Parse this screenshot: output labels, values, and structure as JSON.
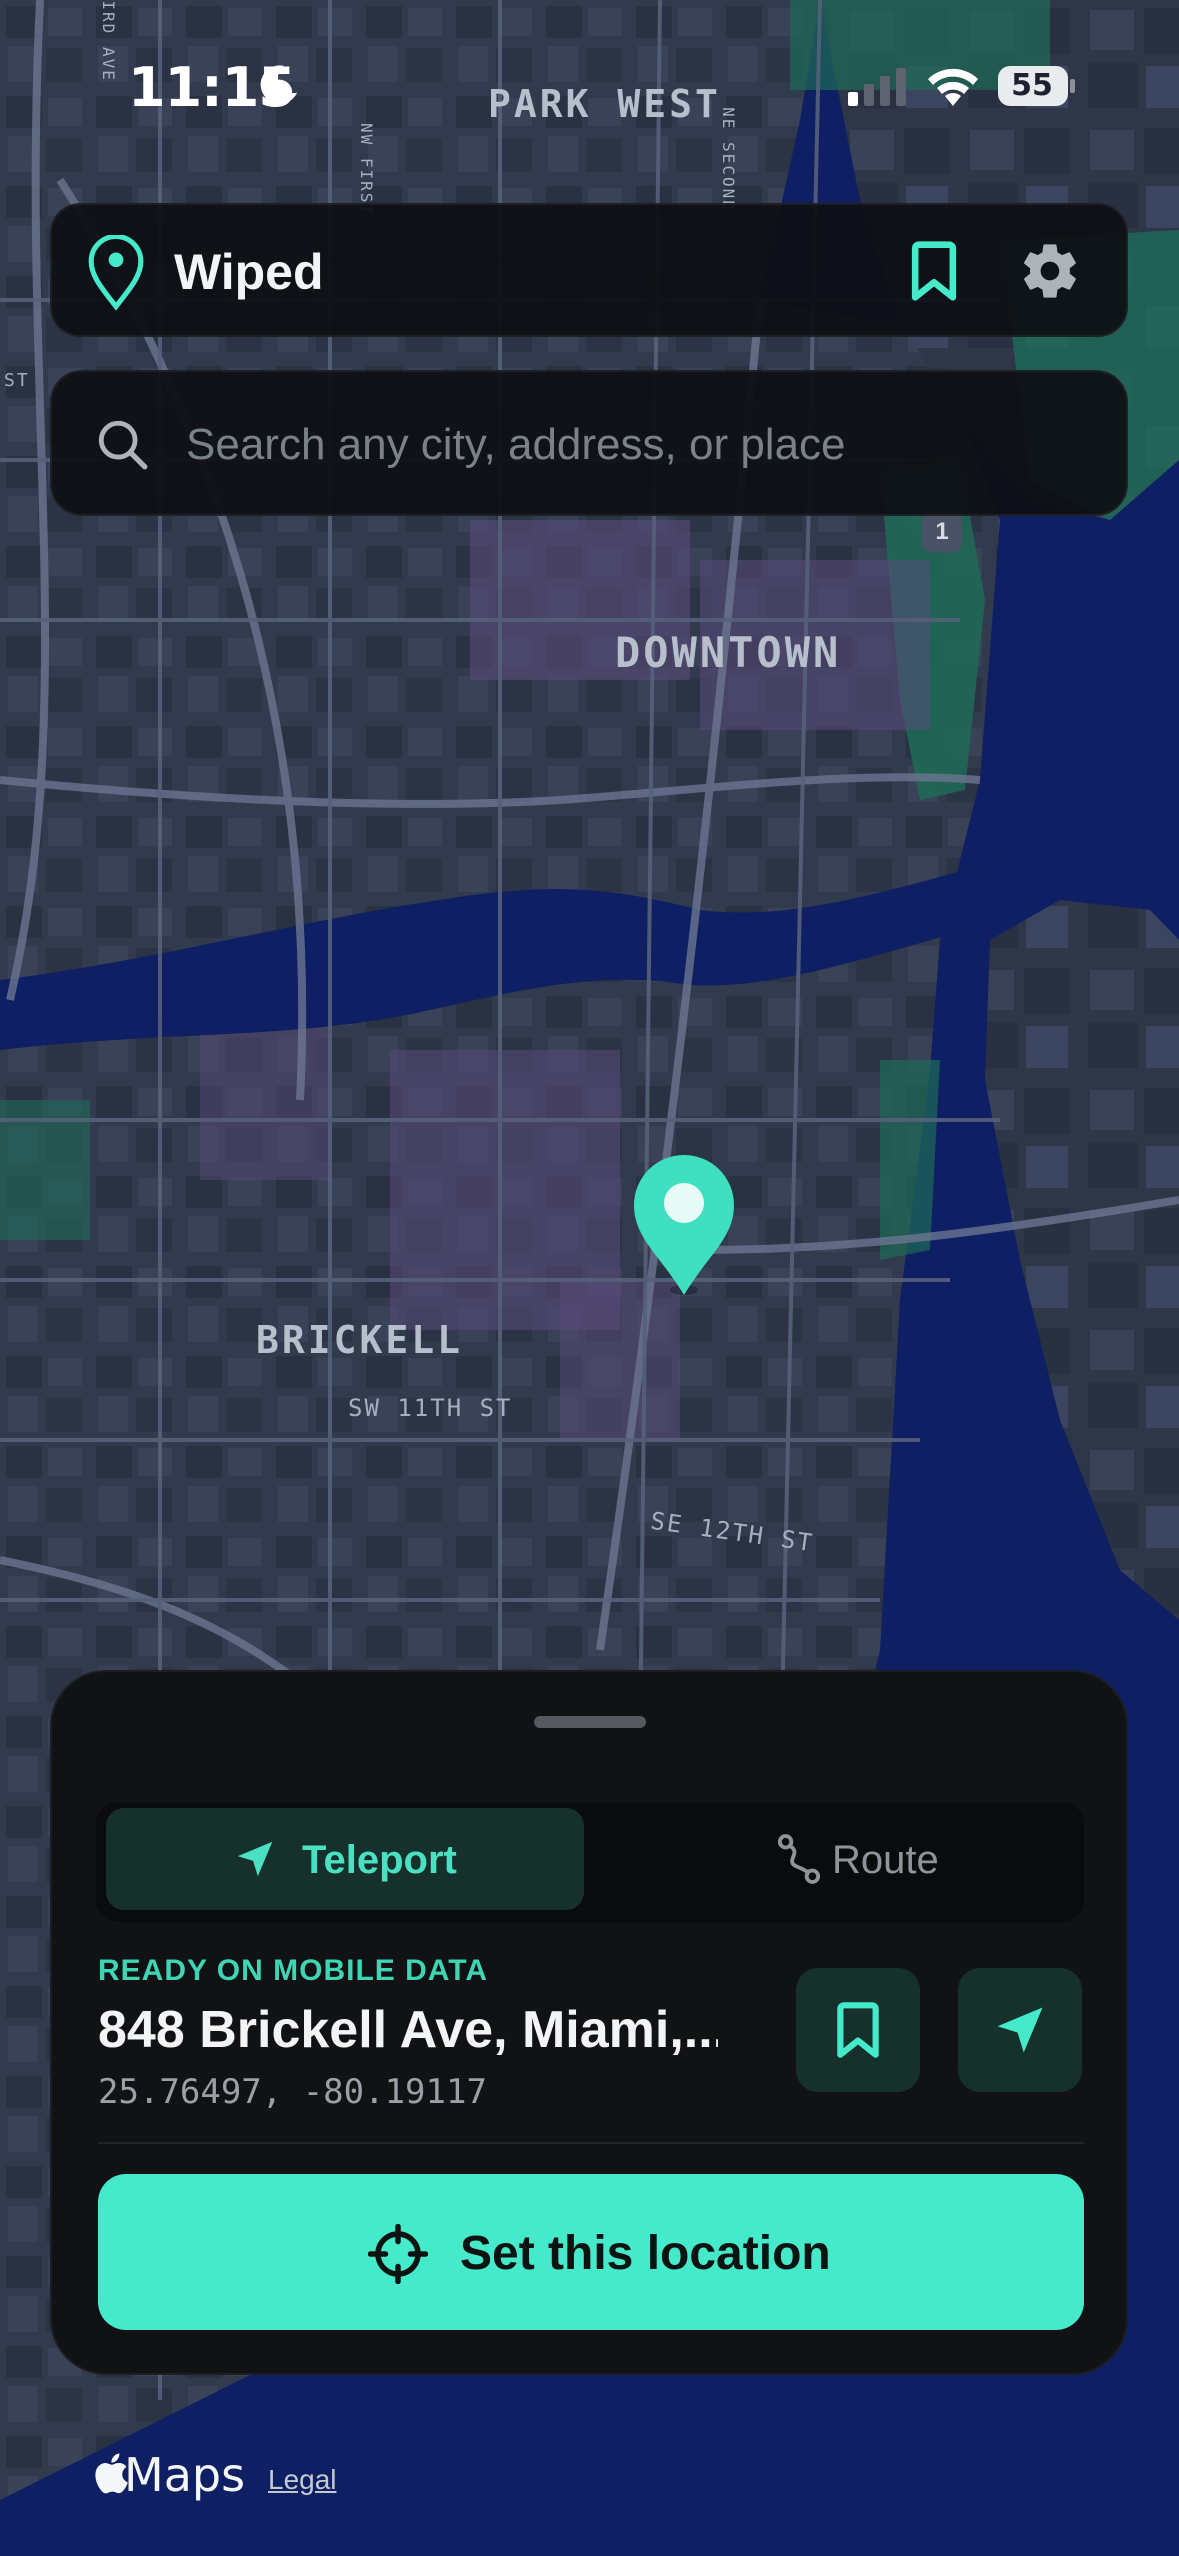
{
  "status_bar": {
    "time": "11:15",
    "battery": "55"
  },
  "header": {
    "app_title": "Wiped"
  },
  "search": {
    "placeholder": "Search any city, address, or place"
  },
  "map": {
    "labels": {
      "park_west": "PARK WEST",
      "downtown": "DOWNTOWN",
      "brickell": "BRICKELL",
      "sw_11th": "SW 11TH ST",
      "se_12th": "SE 12TH ST",
      "third_ave": "THIRD AVE",
      "nw_first": "NW FIRST",
      "ne_second": "NE SECOND",
      "st": "ST",
      "highway": "1"
    }
  },
  "sheet": {
    "tabs": [
      {
        "label": "Teleport",
        "active": true
      },
      {
        "label": "Route",
        "active": false
      }
    ],
    "status": "READY ON MOBILE DATA",
    "address": "848 Brickell Ave, Miami,...",
    "coordinates": "25.76497, -80.19117",
    "cta_label": "Set this location"
  },
  "attribution": {
    "maps": "Maps",
    "legal": "Legal"
  },
  "colors": {
    "accent": "#45eacb",
    "accent_text": "#3ed4b4",
    "water": "#0e1f63"
  }
}
